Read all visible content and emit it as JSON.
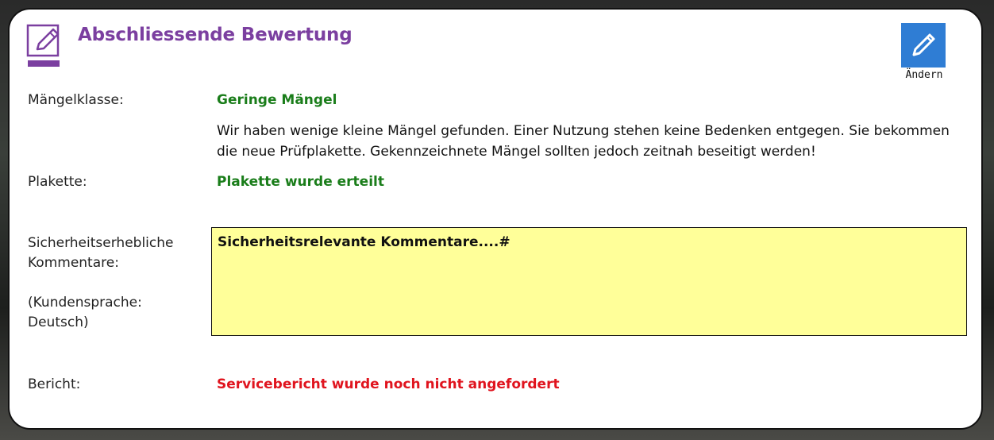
{
  "header": {
    "title": "Abschliessende Bewertung",
    "title_icon": "edit-note-icon",
    "edit_button_icon": "pencil-icon",
    "edit_button_label": "Ändern"
  },
  "fields": {
    "maengelklasse_label": "Mängelklasse:",
    "maengelklasse_value": "Geringe Mängel",
    "maengelklasse_description": "Wir haben wenige kleine Mängel gefunden. Einer Nutzung stehen keine Bedenken entgegen. Sie bekommen die neue Prüfplakette. Gekennzeichnete Mängel sollten jedoch zeitnah beseitigt werden!",
    "plakette_label": "Plakette:",
    "plakette_value": "Plakette wurde erteilt",
    "comments_label": "Sicherheitserhebliche Kommentare:",
    "comments_language": "(Kundensprache: Deutsch)",
    "comments_text": "Sicherheitsrelevante Kommentare....#",
    "bericht_label": "Bericht:",
    "bericht_value": "Servicebericht wurde noch nicht angefordert"
  },
  "colors": {
    "title": "#7b3fa0",
    "success": "#1a7d1a",
    "warning": "#e0141e",
    "comment_background": "#ffff99",
    "edit_button": "#2f7dd4"
  }
}
